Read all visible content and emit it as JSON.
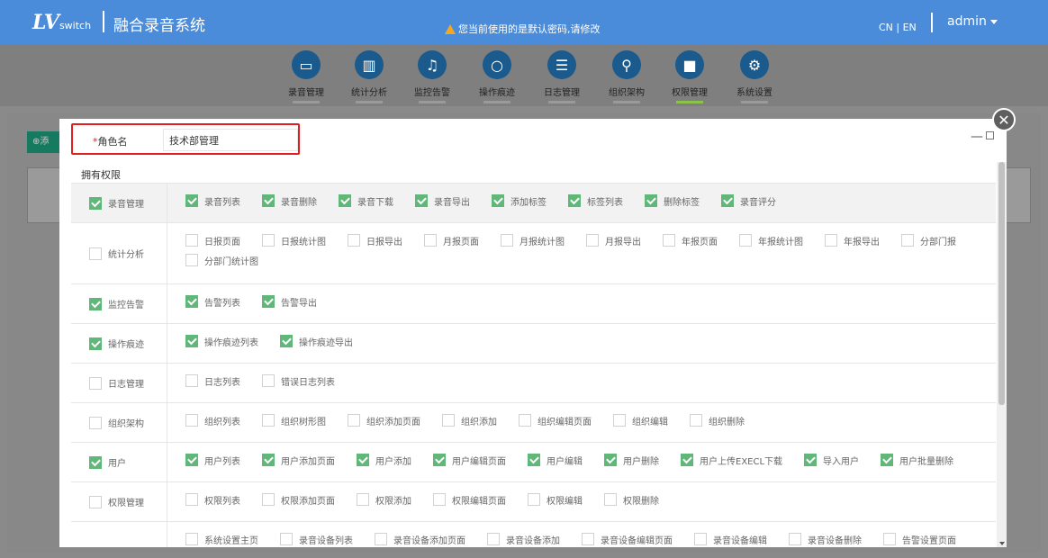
{
  "header": {
    "logo_main": "LV",
    "logo_sub": "switch",
    "app_title": "融合录音系统",
    "warning": "您当前使用的是默认密码,请修改",
    "lang": "CN | EN",
    "user": "admin"
  },
  "nav": [
    {
      "label": "录音管理",
      "icon": "recording-icon",
      "glyph": "▭"
    },
    {
      "label": "统计分析",
      "icon": "bar-chart-icon",
      "glyph": "▥"
    },
    {
      "label": "监控告警",
      "icon": "bell-icon",
      "glyph": "♫"
    },
    {
      "label": "操作痕迹",
      "icon": "search-icon",
      "glyph": "○"
    },
    {
      "label": "日志管理",
      "icon": "log-icon",
      "glyph": "☰"
    },
    {
      "label": "组织架构",
      "icon": "org-chart-icon",
      "glyph": "⚲"
    },
    {
      "label": "权限管理",
      "icon": "lock-icon",
      "glyph": "■"
    },
    {
      "label": "系统设置",
      "icon": "gear-icon",
      "glyph": "⚙"
    }
  ],
  "page": {
    "add_label": "添"
  },
  "modal": {
    "role_name_label": "角色名",
    "role_name_value": "技术部管理",
    "permissions_title": "拥有权限",
    "min_glyph": "—",
    "close_glyph": "✕",
    "rows": [
      {
        "name": "录音管理",
        "checked": true,
        "shade": true,
        "items": [
          {
            "label": "录音列表",
            "checked": true
          },
          {
            "label": "录音删除",
            "checked": true
          },
          {
            "label": "录音下载",
            "checked": true
          },
          {
            "label": "录音导出",
            "checked": true
          },
          {
            "label": "添加标签",
            "checked": true
          },
          {
            "label": "标签列表",
            "checked": true
          },
          {
            "label": "删除标签",
            "checked": true
          },
          {
            "label": "录音评分",
            "checked": true
          }
        ]
      },
      {
        "name": "统计分析",
        "checked": false,
        "shade": false,
        "items": [
          {
            "label": "日报页面",
            "checked": false
          },
          {
            "label": "日报统计图",
            "checked": false
          },
          {
            "label": "日报导出",
            "checked": false
          },
          {
            "label": "月报页面",
            "checked": false
          },
          {
            "label": "月报统计图",
            "checked": false
          },
          {
            "label": "月报导出",
            "checked": false
          },
          {
            "label": "年报页面",
            "checked": false
          },
          {
            "label": "年报统计图",
            "checked": false
          },
          {
            "label": "年报导出",
            "checked": false
          },
          {
            "label": "分部门报",
            "checked": false
          },
          {
            "label": "分部门统计图",
            "checked": false
          }
        ]
      },
      {
        "name": "监控告警",
        "checked": true,
        "shade": false,
        "items": [
          {
            "label": "告警列表",
            "checked": true
          },
          {
            "label": "告警导出",
            "checked": true
          }
        ]
      },
      {
        "name": "操作痕迹",
        "checked": true,
        "shade": false,
        "items": [
          {
            "label": "操作痕迹列表",
            "checked": true
          },
          {
            "label": "操作痕迹导出",
            "checked": true
          }
        ]
      },
      {
        "name": "日志管理",
        "checked": false,
        "shade": false,
        "items": [
          {
            "label": "日志列表",
            "checked": false
          },
          {
            "label": "错误日志列表",
            "checked": false
          }
        ]
      },
      {
        "name": "组织架构",
        "checked": false,
        "shade": false,
        "items": [
          {
            "label": "组织列表",
            "checked": false
          },
          {
            "label": "组织树形图",
            "checked": false
          },
          {
            "label": "组织添加页面",
            "checked": false
          },
          {
            "label": "组织添加",
            "checked": false
          },
          {
            "label": "组织编辑页面",
            "checked": false
          },
          {
            "label": "组织编辑",
            "checked": false
          },
          {
            "label": "组织删除",
            "checked": false
          }
        ]
      },
      {
        "name": "用户",
        "checked": true,
        "shade": false,
        "items": [
          {
            "label": "用户列表",
            "checked": true
          },
          {
            "label": "用户添加页面",
            "checked": true
          },
          {
            "label": "用户添加",
            "checked": true
          },
          {
            "label": "用户编辑页面",
            "checked": true
          },
          {
            "label": "用户编辑",
            "checked": true
          },
          {
            "label": "用户删除",
            "checked": true
          },
          {
            "label": "用户上传EXECL下载",
            "checked": true
          },
          {
            "label": "导入用户",
            "checked": true
          },
          {
            "label": "用户批量删除",
            "checked": true
          }
        ]
      },
      {
        "name": "权限管理",
        "checked": false,
        "shade": false,
        "items": [
          {
            "label": "权限列表",
            "checked": false
          },
          {
            "label": "权限添加页面",
            "checked": false
          },
          {
            "label": "权限添加",
            "checked": false
          },
          {
            "label": "权限编辑页面",
            "checked": false
          },
          {
            "label": "权限编辑",
            "checked": false
          },
          {
            "label": "权限删除",
            "checked": false
          }
        ]
      },
      {
        "name": "",
        "checked": false,
        "shade": false,
        "items": [
          {
            "label": "系统设置主页",
            "checked": false
          },
          {
            "label": "录音设备列表",
            "checked": false
          },
          {
            "label": "录音设备添加页面",
            "checked": false
          },
          {
            "label": "录音设备添加",
            "checked": false
          },
          {
            "label": "录音设备编辑页面",
            "checked": false
          },
          {
            "label": "录音设备编辑",
            "checked": false
          },
          {
            "label": "录音设备删除",
            "checked": false
          },
          {
            "label": "告警设置页面",
            "checked": false
          }
        ]
      }
    ]
  },
  "colors": {
    "header": "#4a8cd9",
    "checked": "#5fb878",
    "highlight": "#e02020",
    "active_nav": "#8bc34a"
  }
}
